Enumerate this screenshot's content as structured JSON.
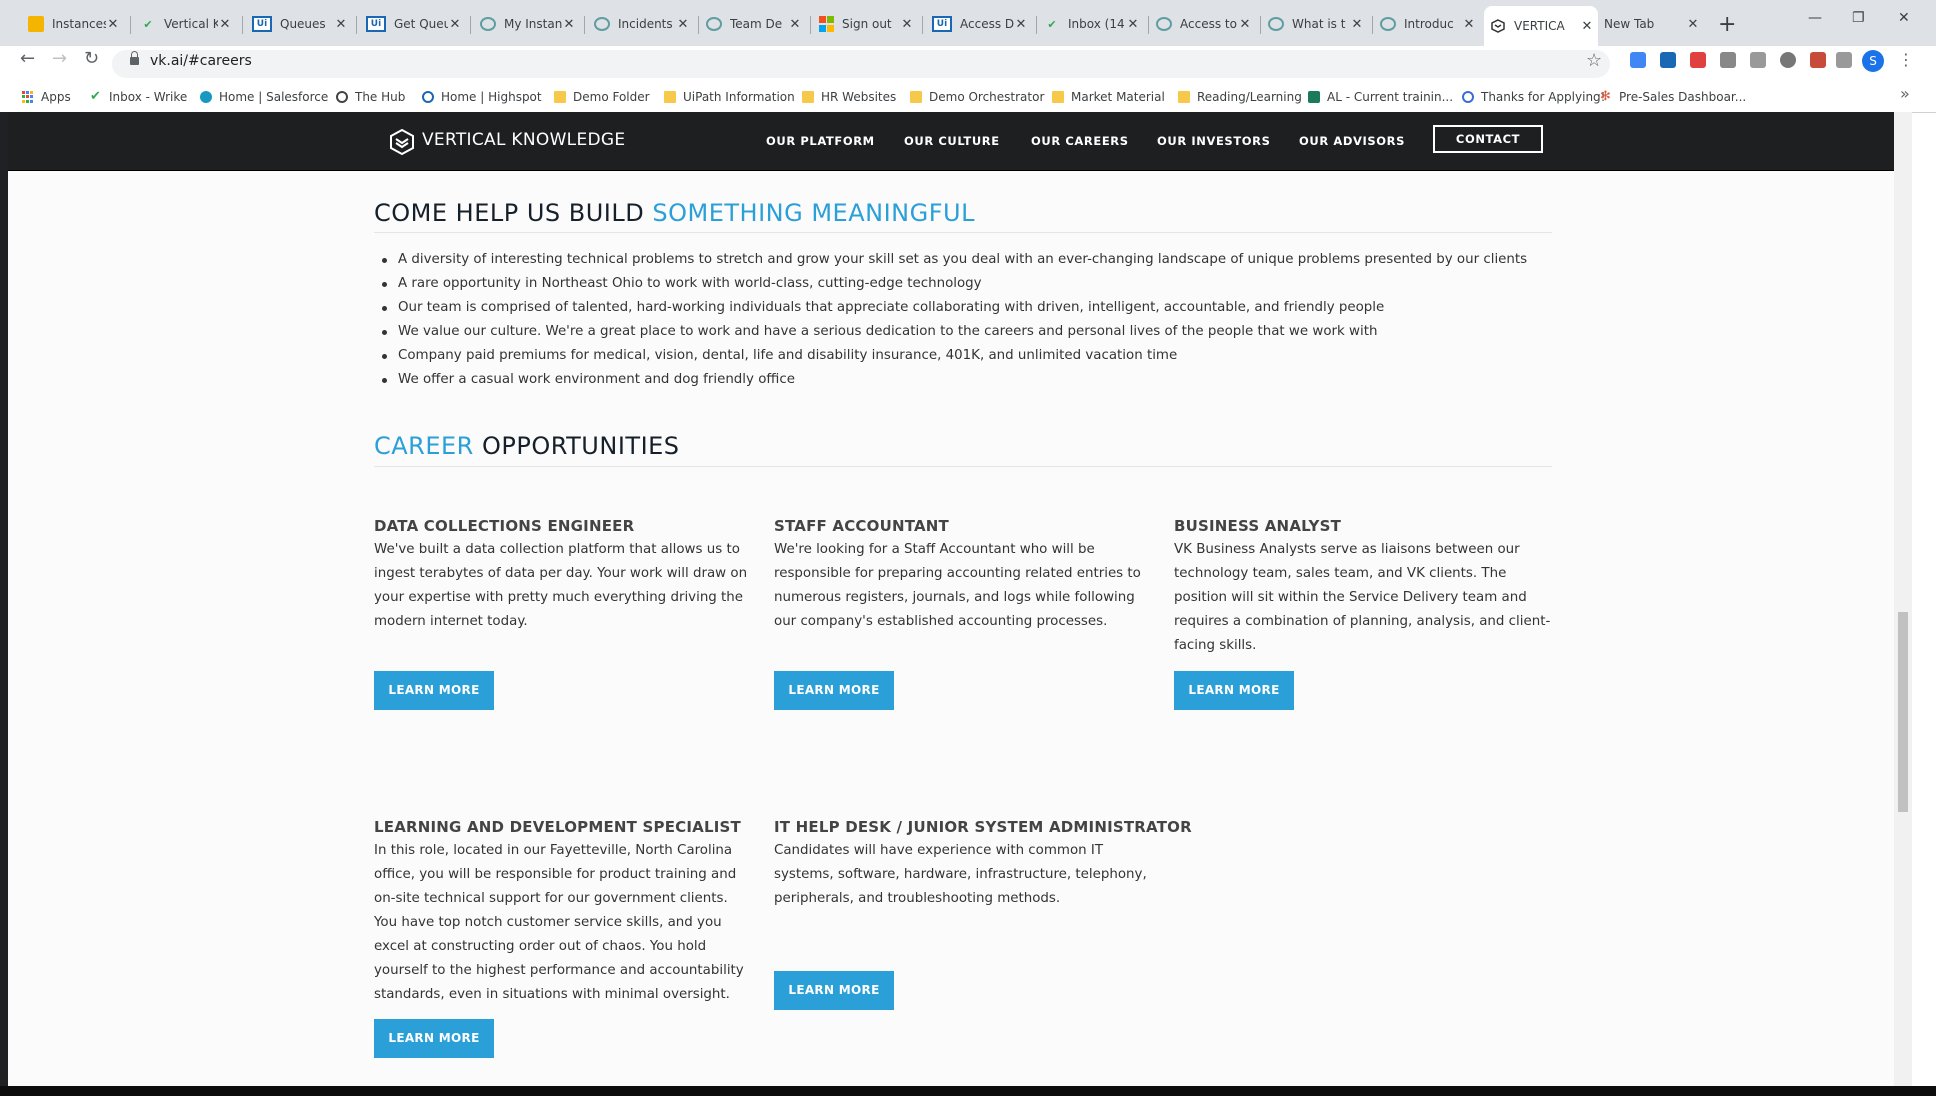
{
  "browser": {
    "tabs": [
      {
        "title": "Instances",
        "icon": "box-icon"
      },
      {
        "title": "Vertical K",
        "icon": "checkmark-icon"
      },
      {
        "title": "Queues",
        "icon": "uipath-icon"
      },
      {
        "title": "Get Queu",
        "icon": "uipath-icon"
      },
      {
        "title": "My Instan",
        "icon": "circle-icon"
      },
      {
        "title": "Incidents",
        "icon": "circle-icon"
      },
      {
        "title": "Team De",
        "icon": "circle-icon"
      },
      {
        "title": "Sign out",
        "icon": "microsoft-icon"
      },
      {
        "title": "Access D",
        "icon": "uipath-icon"
      },
      {
        "title": "Inbox (14",
        "icon": "checkmark-icon"
      },
      {
        "title": "Access to",
        "icon": "circle-icon"
      },
      {
        "title": "What is t",
        "icon": "circle-icon"
      },
      {
        "title": "Introduc",
        "icon": "circle-icon"
      },
      {
        "title": "VERTICA",
        "icon": "vk-icon",
        "active": true
      },
      {
        "title": "New Tab",
        "icon": ""
      }
    ],
    "url": "vk.ai/#careers",
    "avatar_letter": "S",
    "bookmarks": [
      {
        "label": "Apps"
      },
      {
        "label": "Inbox - Wrike"
      },
      {
        "label": "Home | Salesforce"
      },
      {
        "label": "The Hub"
      },
      {
        "label": "Home | Highspot"
      },
      {
        "label": "Demo Folder"
      },
      {
        "label": "UiPath Information"
      },
      {
        "label": "HR Websites"
      },
      {
        "label": "Demo Orchestrator"
      },
      {
        "label": "Market Material"
      },
      {
        "label": "Reading/Learning"
      },
      {
        "label": "AL - Current trainin..."
      },
      {
        "label": "Thanks for Applying!"
      },
      {
        "label": "Pre-Sales Dashboar..."
      }
    ],
    "bookmarks_more": "»"
  },
  "site": {
    "brand": "VERTICAL KNOWLEDGE",
    "nav": [
      "OUR PLATFORM",
      "OUR CULTURE",
      "OUR CAREERS",
      "OUR INVESTORS",
      "OUR ADVISORS"
    ],
    "contact": "CONTACT"
  },
  "meaningful": {
    "title_part1": "COME HELP US BUILD ",
    "title_part2": "SOMETHING MEANINGFUL",
    "bullets": [
      "A diversity of interesting technical problems to stretch and grow your skill set as you deal with an ever-changing landscape of unique problems presented by our clients",
      "A rare opportunity in Northeast Ohio to work with world-class, cutting-edge technology",
      "Our team is comprised of talented, hard-working individuals that appreciate collaborating with driven, intelligent, accountable, and friendly people",
      "We value our culture. We're a great place to work and have a serious dedication to the careers and personal lives of the people that we work with",
      "Company paid premiums for medical, vision, dental, life and disability insurance, 401K, and unlimited vacation time",
      "We offer a casual work environment and dog friendly office"
    ]
  },
  "careers": {
    "title_part1": "CAREER",
    "title_part2": " OPPORTUNITIES",
    "learn_more": "LEARN MORE",
    "jobs": [
      {
        "title": "DATA COLLECTIONS ENGINEER",
        "description": "We've built a data collection platform that allows us to ingest terabytes of data per day. Your work will draw on your expertise with pretty much everything driving the modern internet today."
      },
      {
        "title": "STAFF ACCOUNTANT",
        "description": "We're looking for a Staff Accountant who will be responsible for preparing accounting related entries to numerous registers, journals, and logs while following our company's established accounting processes."
      },
      {
        "title": "BUSINESS ANALYST",
        "description": "VK Business Analysts serve as liaisons between our technology team, sales team, and VK clients. The position will sit within the Service Delivery team and requires a combination of planning, analysis, and client-facing skills."
      },
      {
        "title": "LEARNING AND DEVELOPMENT SPECIALIST",
        "description": "In this role, located in our Fayetteville, North Carolina office, you will be responsible for product training and on-site technical support for our government clients. You have top notch customer service skills, and you excel at constructing order out of chaos. You hold yourself to the highest performance and accountability standards, even in situations with minimal oversight."
      },
      {
        "title": "IT HELP DESK / JUNIOR SYSTEM ADMINISTRATOR",
        "description": "Candidates will have experience with common IT systems, software, hardware, infrastructure, telephony, peripherals, and troubleshooting methods."
      }
    ]
  },
  "colors": {
    "accent": "#2a9fd8",
    "header_bg": "#1d1f21",
    "title_dark": "#16202a"
  }
}
